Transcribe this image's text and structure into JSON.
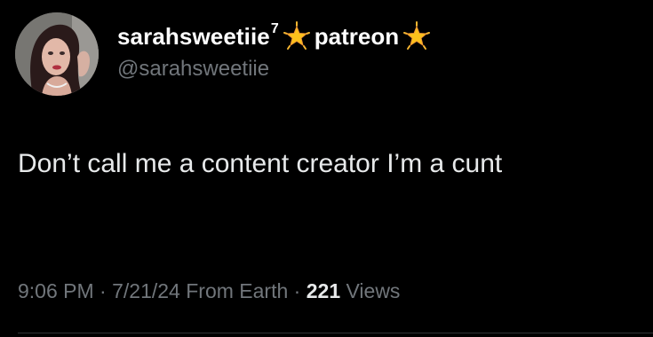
{
  "author": {
    "display_name": "sarahsweetiie",
    "superscript": "7",
    "name_suffix": "patreon",
    "handle": "@sarahsweetiie",
    "avatar_icon": "profile-photo",
    "badge_icon": "glowing-star-emoji"
  },
  "tweet": {
    "text": "Don’t call me a content creator I’m a cunt"
  },
  "meta": {
    "time": "9:06 PM",
    "separator1": " · ",
    "date": "7/21/24",
    "source": " From Earth",
    "separator2": " · ",
    "views_count": "221",
    "views_label": " Views"
  },
  "colors": {
    "background": "#000000",
    "primary_text": "#e7e9ea",
    "secondary_text": "#71767b",
    "divider": "#2f3336",
    "star": "#f7b731"
  }
}
